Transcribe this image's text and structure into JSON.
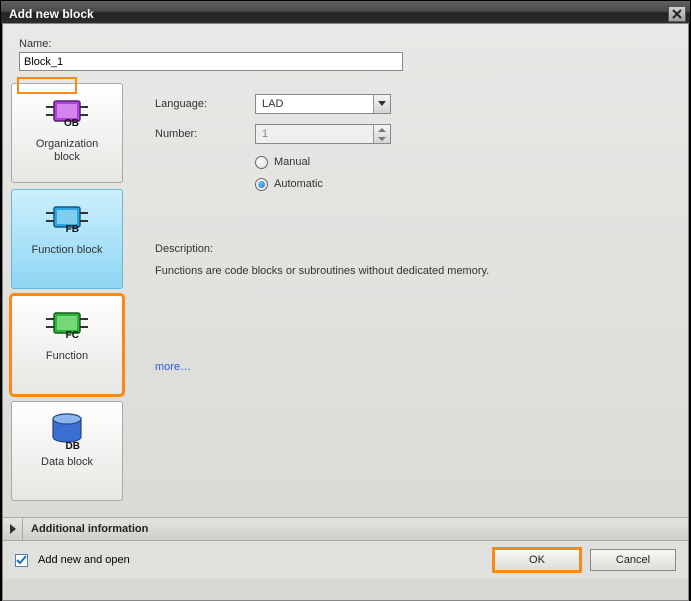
{
  "window": {
    "title": "Add new block"
  },
  "name": {
    "label": "Name:",
    "value": "Block_1"
  },
  "blocks": {
    "ob": {
      "label": "Organization\nblock",
      "tag": "OB",
      "color": "#b142d9"
    },
    "fb": {
      "label": "Function block",
      "tag": "FB",
      "color": "#2aa6e0"
    },
    "fc": {
      "label": "Function",
      "tag": "FC",
      "color": "#2fb336"
    },
    "db": {
      "label": "Data block",
      "tag": "DB",
      "color": "#3a6fd1"
    }
  },
  "form": {
    "language_label": "Language:",
    "language_value": "LAD",
    "number_label": "Number:",
    "number_value": "1",
    "manual_label": "Manual",
    "automatic_label": "Automatic"
  },
  "description": {
    "label": "Description:",
    "text": "Functions are code blocks or subroutines without dedicated memory."
  },
  "more": "more…",
  "addinfo": "Additional information",
  "footer": {
    "addopen": "Add new and open",
    "ok": "OK",
    "cancel": "Cancel"
  }
}
